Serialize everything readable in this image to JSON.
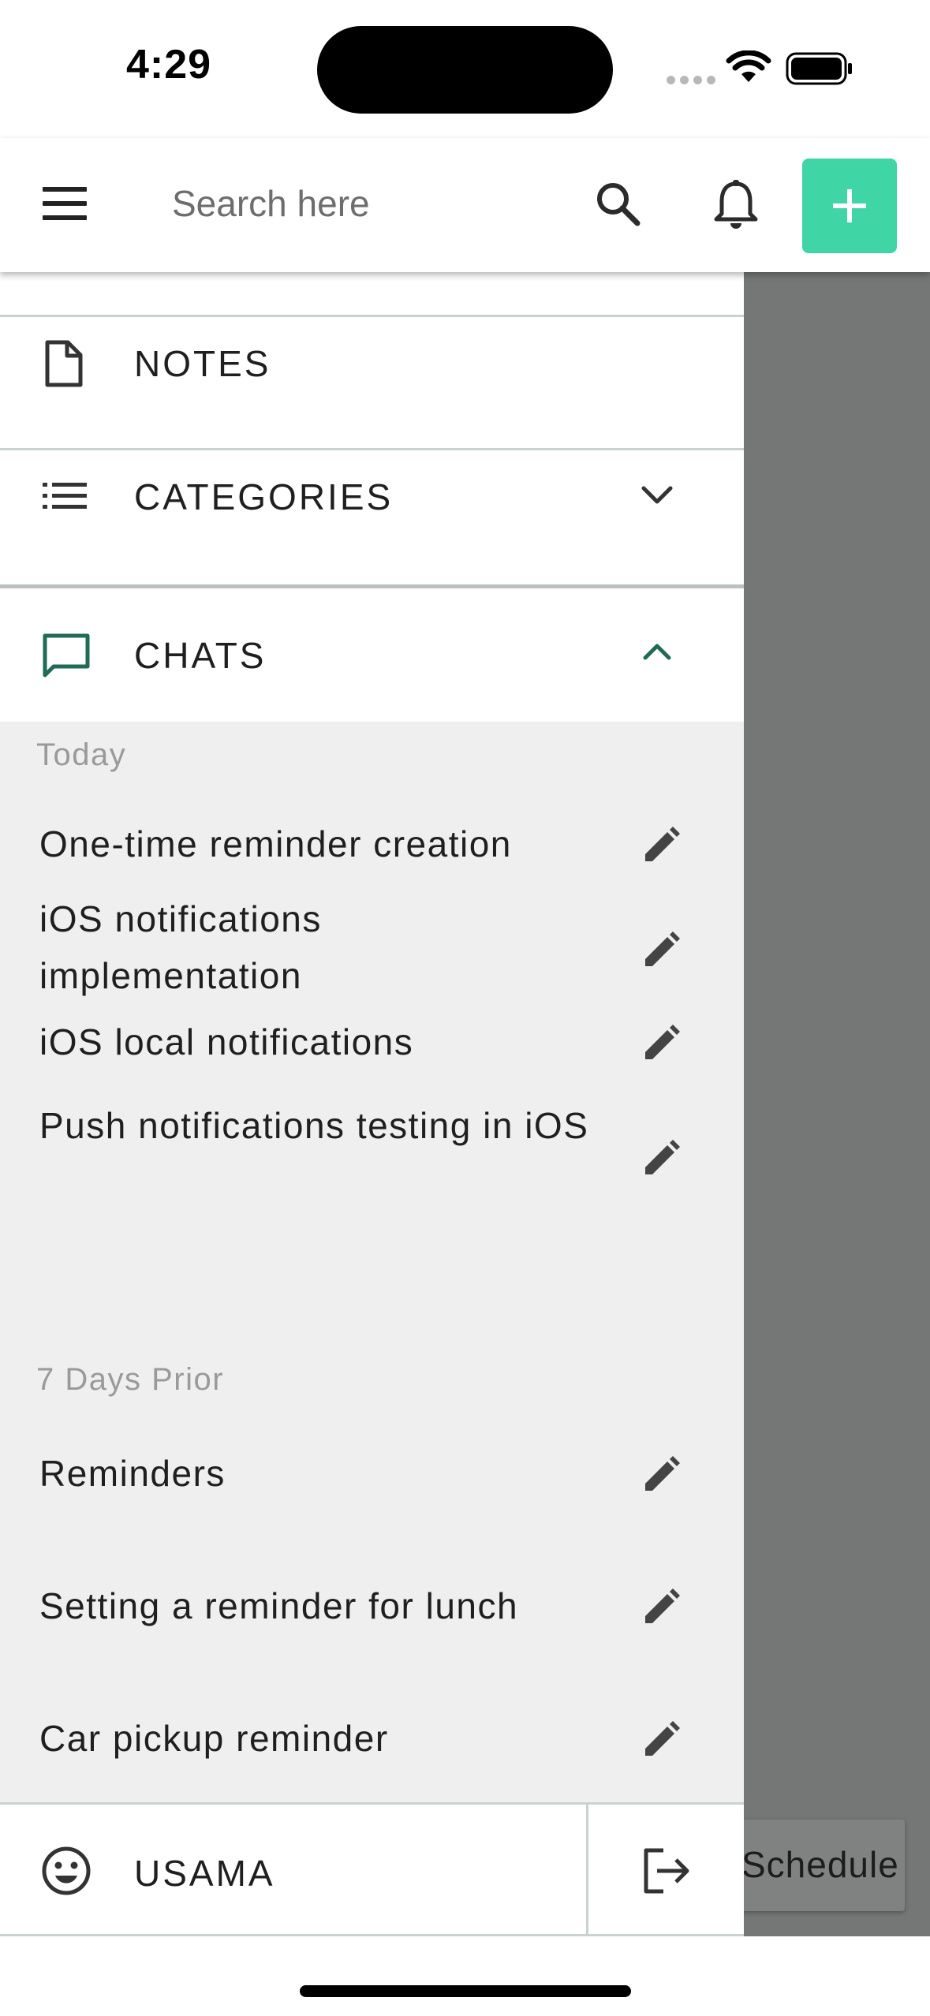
{
  "status_bar": {
    "time": "4:29"
  },
  "header": {
    "search_placeholder": "Search here"
  },
  "drawer": {
    "nav": {
      "notes_label": "NOTES",
      "categories_label": "CATEGORIES",
      "chats_label": "CHATS"
    },
    "sections": [
      {
        "label": "Today",
        "items": [
          {
            "title": "One-time reminder creation"
          },
          {
            "title": "iOS notifications implementation"
          },
          {
            "title": "iOS local notifications"
          },
          {
            "title": "Push notifications testing in iOS"
          }
        ]
      },
      {
        "label": "7 Days Prior",
        "items": [
          {
            "title": "Reminders"
          },
          {
            "title": "Setting a reminder for lunch"
          },
          {
            "title": "Car pickup reminder"
          }
        ]
      }
    ],
    "footer": {
      "user_name": "USAMA"
    }
  },
  "background": {
    "schedule_button_label": "Schedule"
  },
  "colors": {
    "accent": "#3fd5a5",
    "chats_accent": "#1f6b55",
    "scrim": "#757777",
    "chat_panel_bg": "#efefef"
  }
}
